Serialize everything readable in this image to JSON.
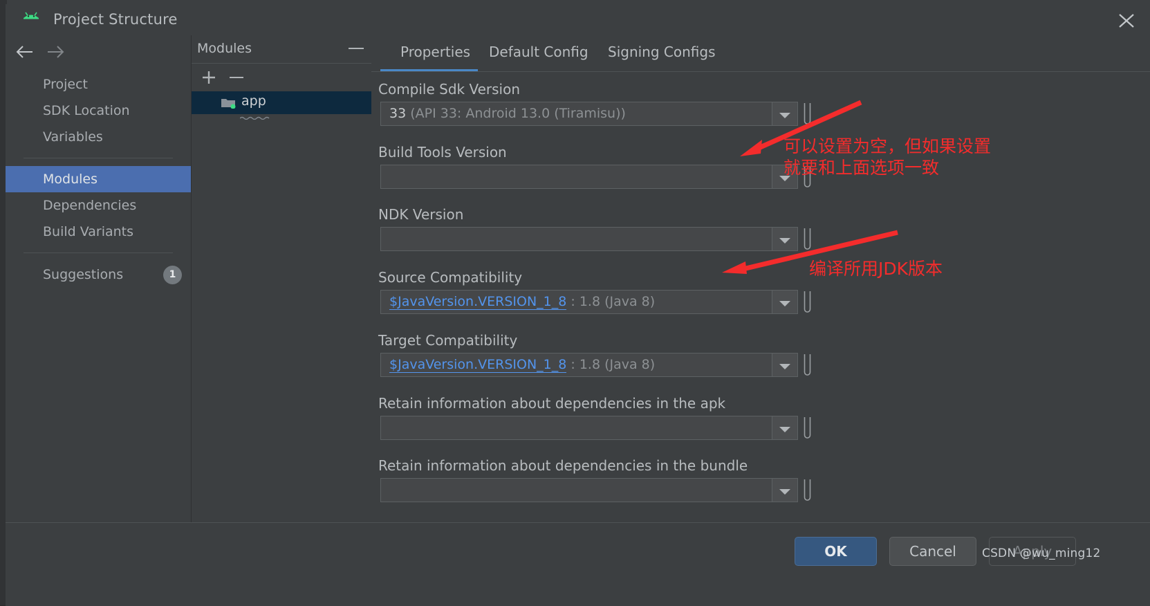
{
  "window": {
    "title": "Project Structure",
    "app_icon": "android-robot-icon",
    "close_icon": "close-icon"
  },
  "nav": {
    "back_icon": "arrow-left-icon",
    "forward_icon": "arrow-right-icon",
    "groups": [
      {
        "items": [
          {
            "label": "Project",
            "selected": false
          },
          {
            "label": "SDK Location",
            "selected": false
          },
          {
            "label": "Variables",
            "selected": false
          }
        ]
      },
      {
        "items": [
          {
            "label": "Modules",
            "selected": true
          },
          {
            "label": "Dependencies",
            "selected": false
          },
          {
            "label": "Build Variants",
            "selected": false
          }
        ]
      }
    ],
    "suggestions": {
      "label": "Suggestions",
      "badge": "1"
    }
  },
  "modules_panel": {
    "title": "Modules",
    "minimize_icon": "minimize-icon",
    "add_icon": "plus-icon",
    "remove_icon": "minus-icon",
    "rows": [
      {
        "name": "app",
        "icon": "module-folder-icon",
        "selected": true
      }
    ]
  },
  "tabs": [
    {
      "label": "Properties",
      "active": true
    },
    {
      "label": "Default Config",
      "active": false
    },
    {
      "label": "Signing Configs",
      "active": false
    }
  ],
  "fields": [
    {
      "label": "Compile Sdk Version",
      "value_strong": "33",
      "value_dim": " (API 33: Android 13.0 (Tiramisu))",
      "value_var": "",
      "dropdown_icon": "chevron-down-icon"
    },
    {
      "label": "Build Tools Version",
      "value_strong": "",
      "value_dim": "",
      "value_var": "",
      "dropdown_icon": "chevron-down-icon"
    },
    {
      "label": "NDK Version",
      "value_strong": "",
      "value_dim": "",
      "value_var": "",
      "dropdown_icon": "chevron-down-icon"
    },
    {
      "label": "Source Compatibility",
      "value_strong": "",
      "value_var": "$JavaVersion.VERSION_1_8",
      "value_dim": " : 1.8 (Java 8)",
      "dropdown_icon": "chevron-down-icon"
    },
    {
      "label": "Target Compatibility",
      "value_strong": "",
      "value_var": "$JavaVersion.VERSION_1_8",
      "value_dim": " : 1.8 (Java 8)",
      "dropdown_icon": "chevron-down-icon"
    },
    {
      "label": "Retain information about dependencies in the apk",
      "value_strong": "",
      "value_dim": "",
      "value_var": "",
      "dropdown_icon": "chevron-down-icon"
    },
    {
      "label": "Retain information about dependencies in the bundle",
      "value_strong": "",
      "value_dim": "",
      "value_var": "",
      "dropdown_icon": "chevron-down-icon"
    }
  ],
  "annotations": [
    {
      "line1": "可以设置为空，但如果设置",
      "line2": "就要和上面选项一致",
      "color": "#f42c2c"
    },
    {
      "line1": "编译所用JDK版本",
      "line2": "",
      "color": "#f42c2c"
    }
  ],
  "buttons": {
    "ok": "OK",
    "cancel": "Cancel",
    "apply": "Apply"
  },
  "watermark": "CSDN @wu_ming12",
  "colors": {
    "accent_blue": "#4b6eaf",
    "tab_underline": "#4a88c7",
    "variable_link": "#5394ec",
    "annotation_red": "#f42c2c",
    "selection_row": "#0d293e"
  }
}
